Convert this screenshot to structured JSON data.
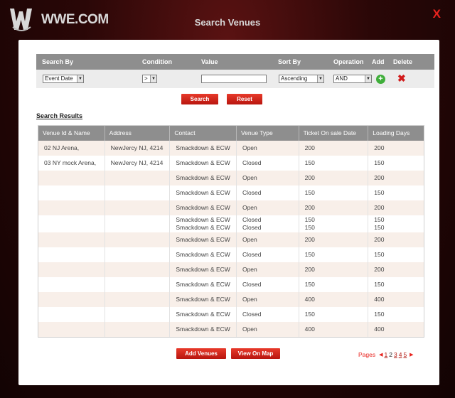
{
  "header": {
    "logo_text": "WWE.COM",
    "title": "Search Venues",
    "close_label": "X"
  },
  "filter": {
    "headers": {
      "search_by": "Search By",
      "condition": "Condition",
      "value": "Value",
      "sort_by": "Sort By",
      "operation": "Operation",
      "add": "Add",
      "delete": "Delete"
    },
    "search_by_value": "Event Date",
    "condition_value": ">",
    "value_text": "",
    "sort_by_value": "Ascending",
    "operation_value": "AND"
  },
  "buttons": {
    "search": "Search",
    "reset": "Reset",
    "add_venues": "Add Venues",
    "view_on_map": "View On Map"
  },
  "results": {
    "label": "Search Results",
    "columns": [
      "Venue Id & Name",
      "Address",
      "Contact",
      "Venue Type",
      "Ticket On sale Date",
      "Loading Days"
    ],
    "rows": [
      {
        "venue": "02 NJ Arena,",
        "address": "NewJercy NJ, 4214",
        "contact": "Smackdown & ECW",
        "type": "Open",
        "ticket": "200",
        "loading": "200"
      },
      {
        "venue": "03 NY mock Arena,",
        "address": "NewJercy NJ, 4214",
        "contact": "Smackdown & ECW",
        "type": "Closed",
        "ticket": "150",
        "loading": "150"
      },
      {
        "venue": "",
        "address": "",
        "contact": "Smackdown & ECW",
        "type": "Open",
        "ticket": "200",
        "loading": "200"
      },
      {
        "venue": "",
        "address": "",
        "contact": "Smackdown & ECW",
        "type": "Closed",
        "ticket": "150",
        "loading": "150"
      },
      {
        "venue": "",
        "address": "",
        "contact": "Smackdown & ECW",
        "type": "Open",
        "ticket": "200",
        "loading": "200"
      },
      {
        "venue": "",
        "address": "",
        "contact": "Smackdown & ECW",
        "contact2": "Smackdown & ECW",
        "type": "Closed",
        "type2": "Closed",
        "ticket": "150",
        "ticket2": "150",
        "loading": "150",
        "loading2": "150"
      },
      {
        "venue": "",
        "address": "",
        "contact": "Smackdown & ECW",
        "type": "Open",
        "ticket": "200",
        "loading": "200"
      },
      {
        "venue": "",
        "address": "",
        "contact": "Smackdown & ECW",
        "type": "Closed",
        "ticket": "150",
        "loading": "150"
      },
      {
        "venue": "",
        "address": "",
        "contact": "Smackdown & ECW",
        "type": "Open",
        "ticket": "200",
        "loading": "200"
      },
      {
        "venue": "",
        "address": "",
        "contact": "Smackdown & ECW",
        "type": "Closed",
        "ticket": "150",
        "loading": "150"
      },
      {
        "venue": "",
        "address": "",
        "contact": "Smackdown & ECW",
        "type": "Open",
        "ticket": "400",
        "loading": "400"
      },
      {
        "venue": "",
        "address": "",
        "contact": "Smackdown & ECW",
        "type": "Closed",
        "ticket": "150",
        "loading": "150"
      },
      {
        "venue": "",
        "address": "",
        "contact": "Smackdown & ECW",
        "type": "Open",
        "ticket": "400",
        "loading": "400"
      }
    ]
  },
  "pager": {
    "label": "Pages",
    "pages": [
      "1",
      "2",
      "3",
      "4",
      "5"
    ],
    "current": "2"
  },
  "colors": {
    "accent": "#e8231e",
    "header_gray": "#8e8e8e",
    "row_tint": "#f8efe9"
  }
}
